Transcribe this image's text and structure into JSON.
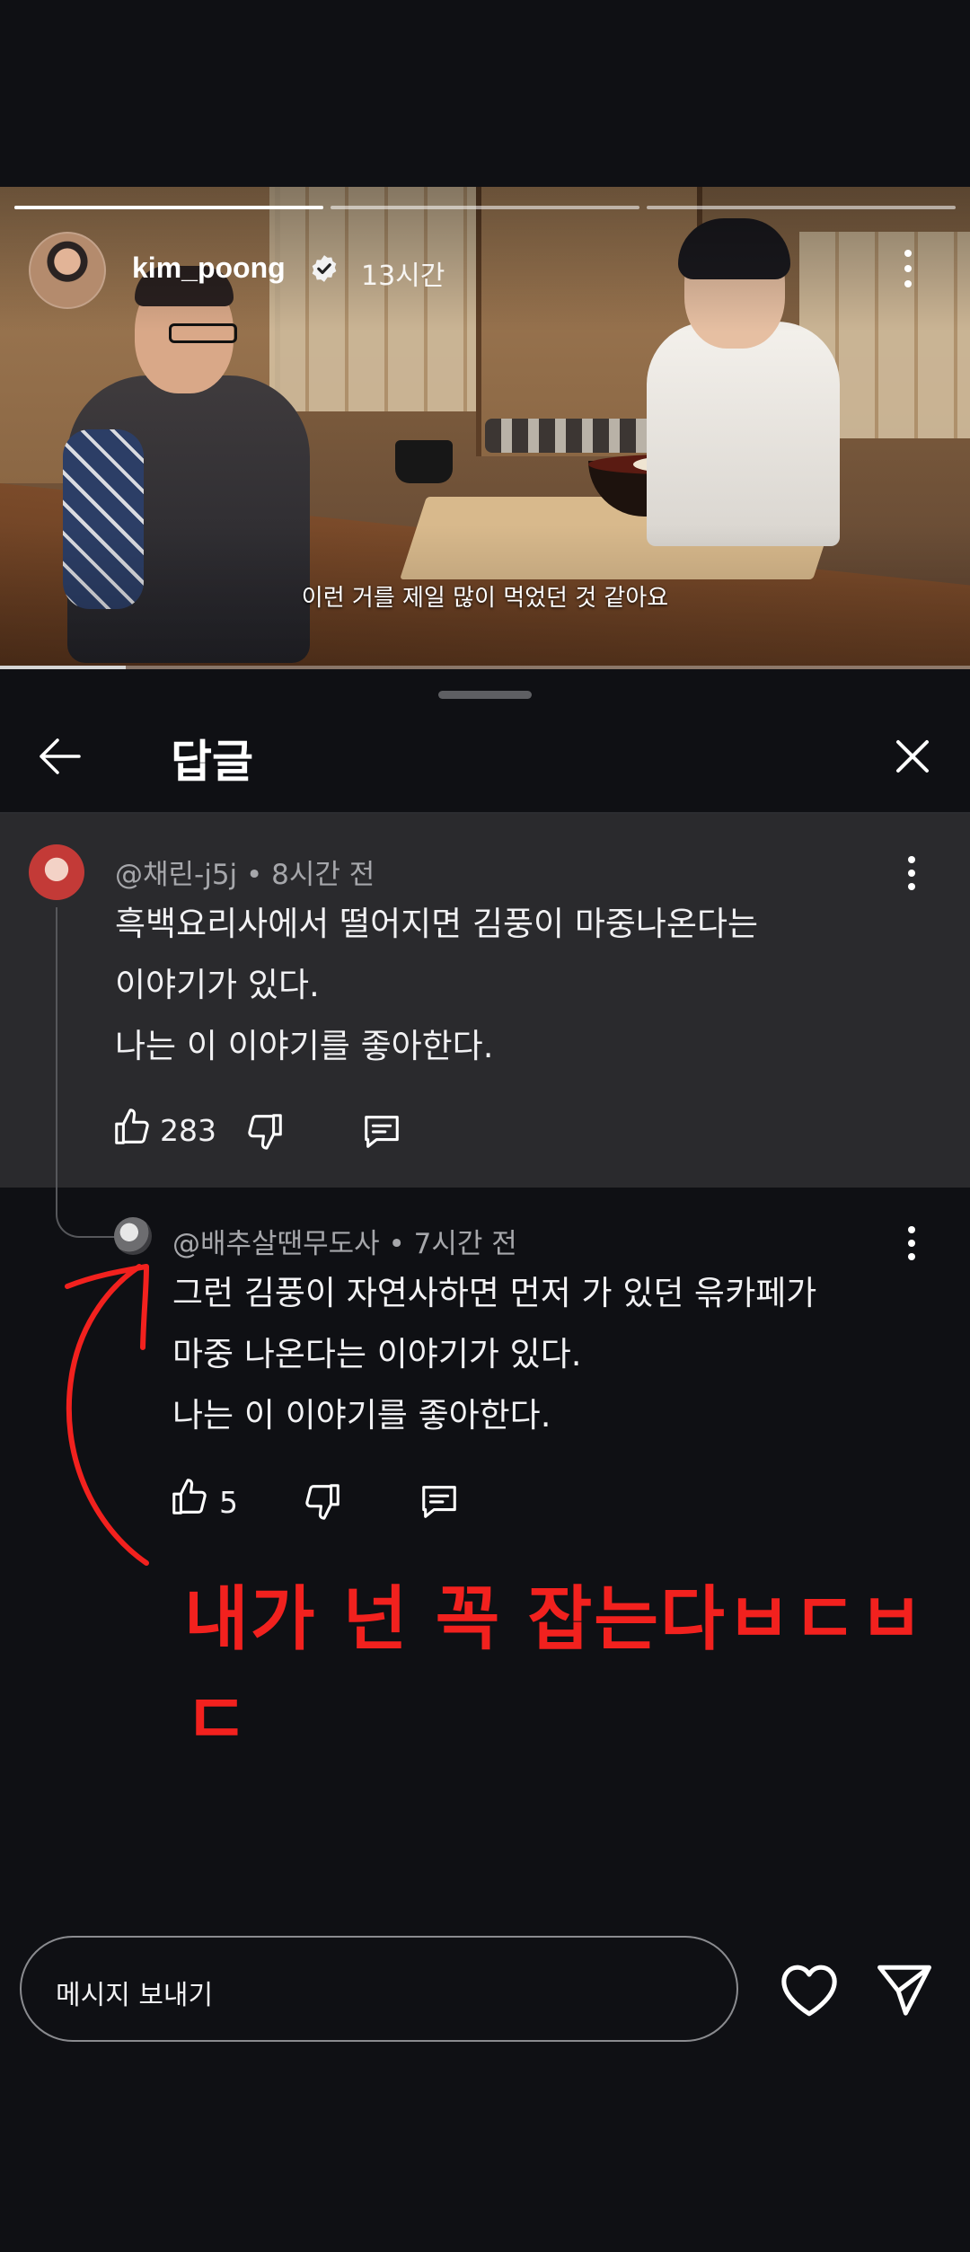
{
  "story": {
    "username": "kim_poong",
    "time": "13시간",
    "subtitle": "이런 거를 제일 많이 먹었던 것 같아요",
    "segments": 3,
    "active_segment": 1,
    "video_progress": 0.13
  },
  "sheet": {
    "title": "답글"
  },
  "comments": [
    {
      "meta": "@채린-j5j • 8시간 전",
      "lines": [
        "흑백요리사에서 떨어지면 김풍이 마중나온다는",
        "이야기가 있다.",
        "나는 이 이야기를 좋아한다."
      ],
      "likes": "283"
    },
    {
      "meta": "@배추살땐무도사 • 7시간 전",
      "lines": [
        "그런 김풍이 자연사하면 먼저 가 있던 윾카페가",
        "마중 나온다는 이야기가 있다.",
        "나는 이 이야기를 좋아한다."
      ],
      "likes": "5"
    }
  ],
  "annotation": "내가 넌 꼭 잡는다ㅂㄷㅂㄷ",
  "message_input": {
    "placeholder": "메시지 보내기"
  },
  "colors": {
    "background": "#0f1014",
    "highlight_card": "#2a2a2d",
    "annotation_red": "#f2211e"
  },
  "icons": [
    "back-arrow-icon",
    "close-icon",
    "kebab-icon",
    "thumbs-up-icon",
    "thumbs-down-icon",
    "reply-icon",
    "heart-icon",
    "send-icon",
    "verified-icon"
  ]
}
